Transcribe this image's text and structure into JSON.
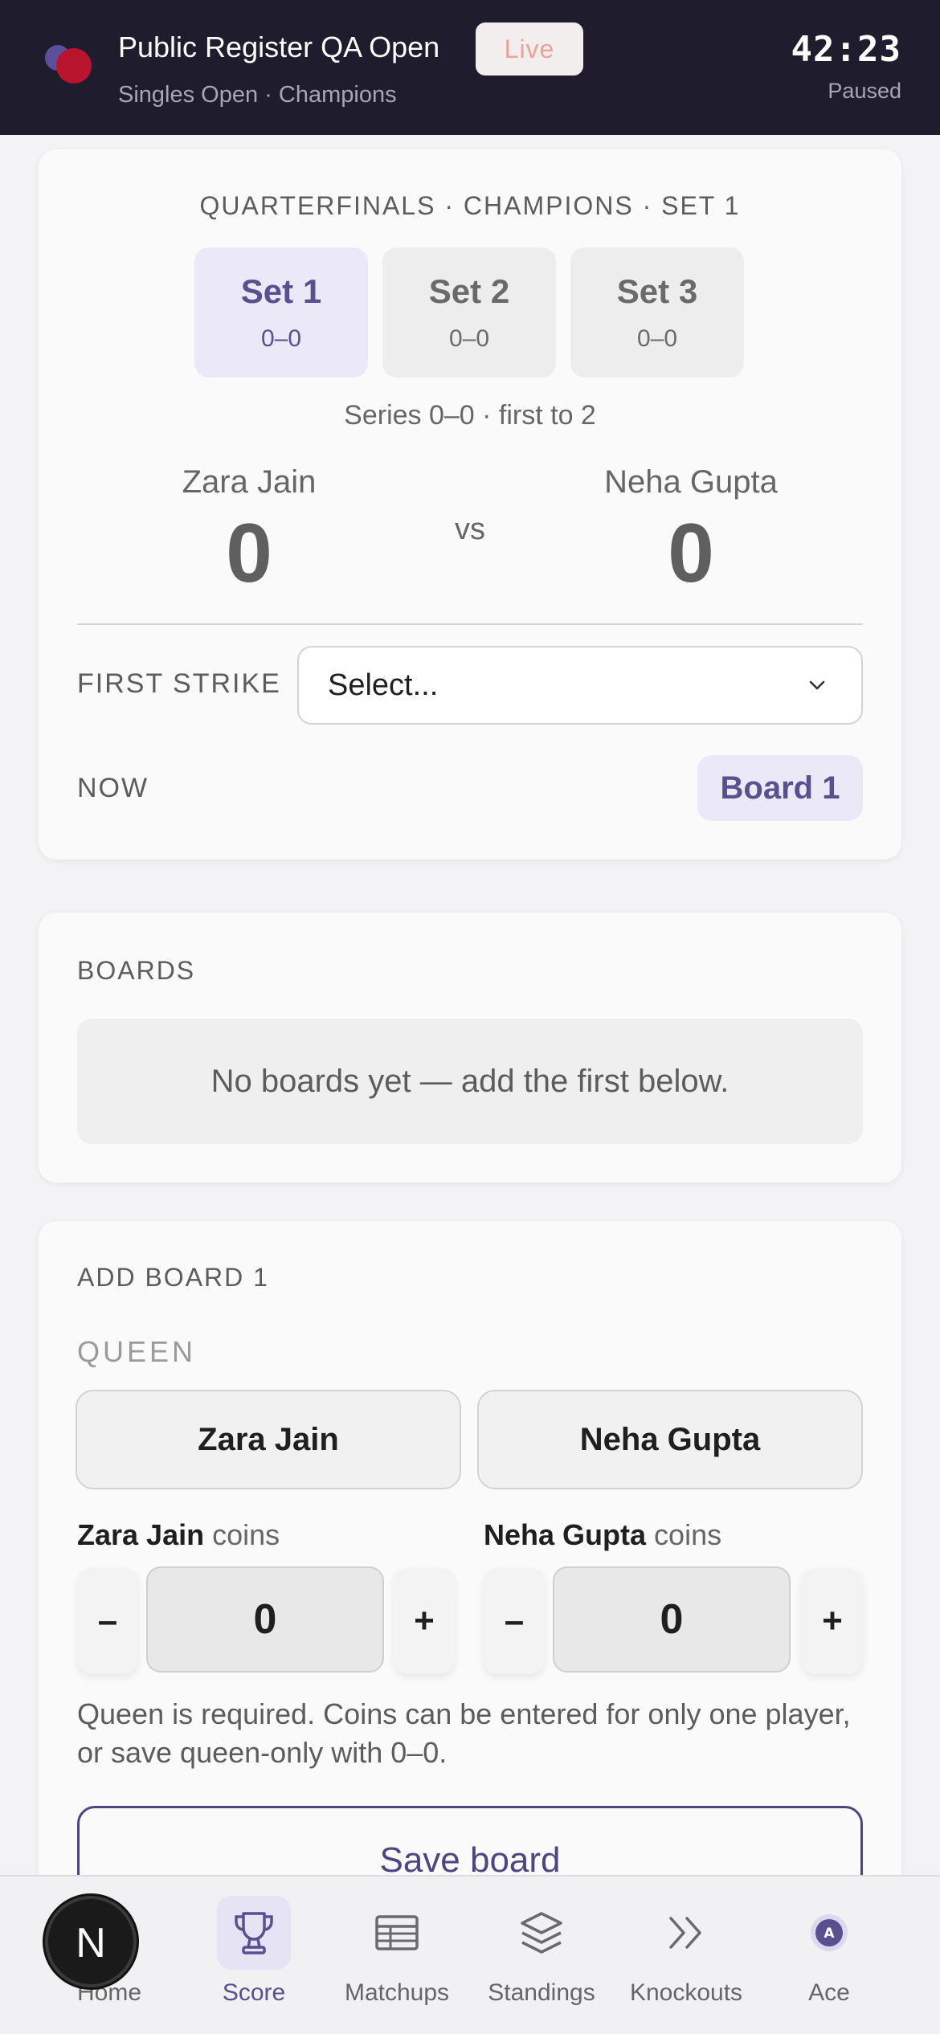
{
  "header": {
    "title": "Public Register QA Open",
    "live_label": "Live",
    "subtitle": "Singles Open · Champions",
    "timer": "42:23",
    "timer_status": "Paused"
  },
  "match": {
    "round_title": "QUARTERFINALS · CHAMPIONS · SET 1",
    "sets": [
      {
        "name": "Set 1",
        "score": "0–0",
        "active": true
      },
      {
        "name": "Set 2",
        "score": "0–0",
        "active": false
      },
      {
        "name": "Set 3",
        "score": "0–0",
        "active": false
      }
    ],
    "series": "Series 0–0 · first to 2",
    "player_a": {
      "name": "Zara Jain",
      "score": "0"
    },
    "player_b": {
      "name": "Neha Gupta",
      "score": "0"
    },
    "vs": "vs",
    "first_strike_label": "FIRST STRIKE",
    "first_strike_value": "Select...",
    "now_label": "NOW",
    "now_board": "Board 1"
  },
  "boards": {
    "label": "BOARDS",
    "empty_message": "No boards yet — add the first below."
  },
  "add_board": {
    "label": "ADD BOARD 1",
    "queen_label": "QUEEN",
    "queen_a": "Zara Jain",
    "queen_b": "Neha Gupta",
    "coins_a_name": "Zara Jain",
    "coins_b_name": "Neha Gupta",
    "coins_suffix": "coins",
    "coins_a_value": "0",
    "coins_b_value": "0",
    "minus": "–",
    "plus": "+",
    "hint": "Queen is required. Coins can be entered for only one player, or save queen-only with 0–0.",
    "save_label": "Save board"
  },
  "nav": {
    "items": [
      {
        "label": "Home",
        "icon": "home-icon"
      },
      {
        "label": "Score",
        "icon": "trophy-icon",
        "active": true
      },
      {
        "label": "Matchups",
        "icon": "table-icon"
      },
      {
        "label": "Standings",
        "icon": "layers-icon"
      },
      {
        "label": "Knockouts",
        "icon": "double-chevron-icon"
      },
      {
        "label": "Ace",
        "icon": "avatar-icon"
      }
    ],
    "fab_letter": "N"
  },
  "colors": {
    "header_bg": "#1e1c2d",
    "accent": "#5a4f8f",
    "live_text": "#f0a09a",
    "brand_red": "#b8142e"
  }
}
